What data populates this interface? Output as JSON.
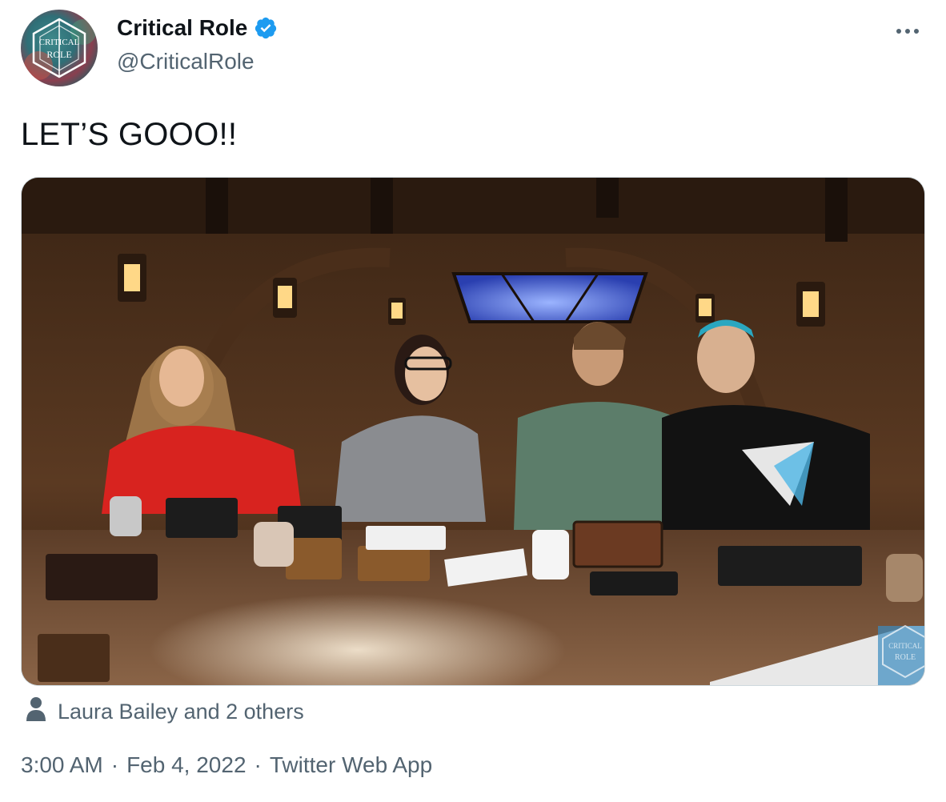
{
  "user": {
    "display_name": "Critical Role",
    "handle": "@CriticalRole",
    "verified": true,
    "avatar_icon": "critical-role-logo-icon"
  },
  "tweet": {
    "text": "LET’S GOOO!!",
    "media_icon": "photo-icon"
  },
  "tagged": {
    "icon": "person-icon",
    "text": "Laura Bailey and 2 others"
  },
  "meta": {
    "time": "3:00 AM",
    "separator": "·",
    "date": "Feb 4, 2022",
    "source": "Twitter Web App"
  },
  "colors": {
    "verified_blue": "#1d9bf0",
    "secondary_text": "#536471",
    "primary_text": "#0f1419"
  }
}
